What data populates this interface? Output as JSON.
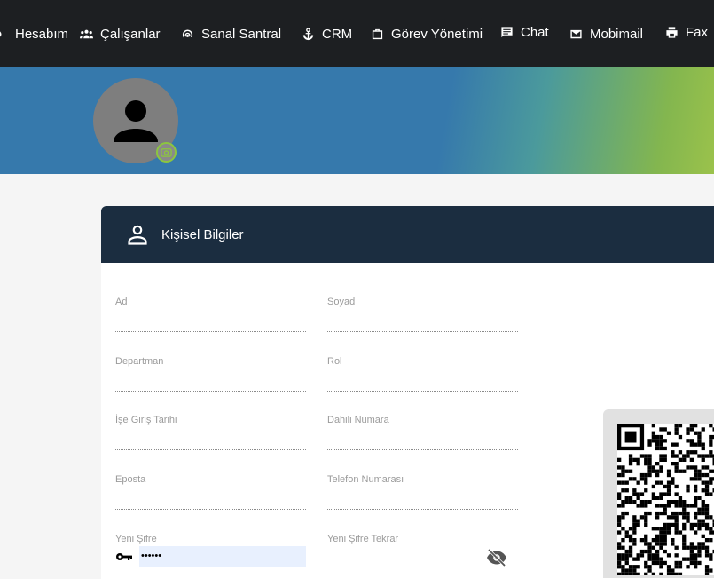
{
  "nav": {
    "items": [
      {
        "label": "Hesabım",
        "icon": "account-icon"
      },
      {
        "label": "Çalışanlar",
        "icon": "people-icon"
      },
      {
        "label": "Sanal Santral",
        "icon": "signal-icon"
      },
      {
        "label": "CRM",
        "icon": "anchor-icon"
      },
      {
        "label": "Görev Yönetimi",
        "icon": "briefcase-icon"
      },
      {
        "label": "Chat",
        "icon": "chat-icon"
      },
      {
        "label": "Mobimail",
        "icon": "mail-icon"
      },
      {
        "label": "Fax",
        "icon": "printer-icon"
      }
    ]
  },
  "card": {
    "title": "Kişisel Bilgiler"
  },
  "form": {
    "ad": {
      "label": "Ad",
      "value": ""
    },
    "soyad": {
      "label": "Soyad",
      "value": ""
    },
    "departman": {
      "label": "Departman",
      "value": ""
    },
    "rol": {
      "label": "Rol",
      "value": ""
    },
    "ise_giris": {
      "label": "İşe Giriş Tarihi",
      "value": ""
    },
    "dahili": {
      "label": "Dahili Numara",
      "value": ""
    },
    "eposta": {
      "label": "Eposta",
      "value": ""
    },
    "telefon": {
      "label": "Telefon Numarası",
      "value": ""
    },
    "yeni_sifre": {
      "label": "Yeni Şifre",
      "value": "••••••"
    },
    "yeni_sifre_tekrar": {
      "label": "Yeni Şifre Tekrar",
      "value": ""
    }
  },
  "colors": {
    "nav_bg": "#1d1f22",
    "header_bg": "#1b2d40",
    "banner_blue": "#3679ac",
    "banner_green": "#9bc24b",
    "camera_ring": "#8cc63f"
  }
}
